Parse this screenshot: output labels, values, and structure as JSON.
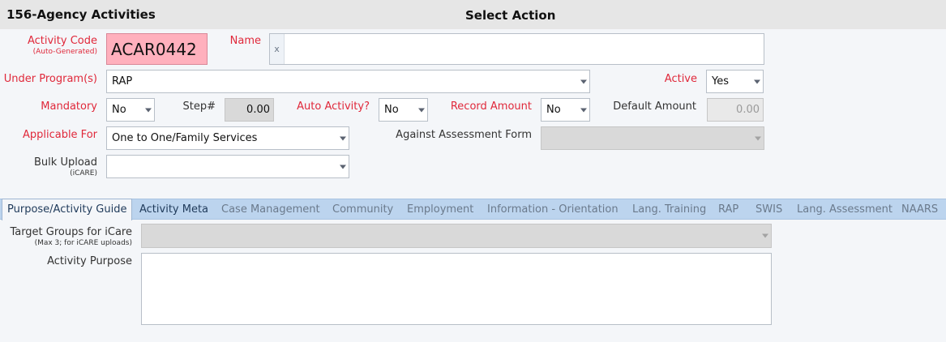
{
  "header": {
    "module_title": "156-Agency Activities",
    "action_title": "Select Action"
  },
  "form": {
    "activity_code": {
      "label": "Activity Code",
      "sub_label": "(Auto-Generated)",
      "value": "ACAR0442"
    },
    "name": {
      "label": "Name",
      "prefix": "x",
      "value": ""
    },
    "under_program": {
      "label": "Under Program(s)",
      "value": "RAP"
    },
    "active": {
      "label": "Active",
      "value": "Yes"
    },
    "mandatory": {
      "label": "Mandatory",
      "value": "No"
    },
    "step": {
      "label": "Step#",
      "value": "0.00"
    },
    "auto_activity": {
      "label": "Auto Activity?",
      "value": "No"
    },
    "record_amount": {
      "label": "Record Amount",
      "value": "No"
    },
    "default_amount": {
      "label": "Default Amount",
      "value": "0.00"
    },
    "applicable_for": {
      "label": "Applicable For",
      "value": "One to One/Family Services"
    },
    "against_assessment_form": {
      "label": "Against Assessment Form",
      "value": ""
    },
    "bulk_upload": {
      "label": "Bulk Upload",
      "sub_label": "(iCARE)",
      "value": ""
    }
  },
  "tabs": [
    {
      "label": "Purpose/Activity Guide"
    },
    {
      "label": "Activity Meta"
    },
    {
      "label": "Case Management"
    },
    {
      "label": "Community"
    },
    {
      "label": "Employment"
    },
    {
      "label": "Information - Orientation"
    },
    {
      "label": "Lang. Training"
    },
    {
      "label": "RAP"
    },
    {
      "label": "SWIS"
    },
    {
      "label": "Lang. Assessment"
    },
    {
      "label": "NAARS"
    }
  ],
  "tab_content": {
    "target_groups": {
      "label": "Target Groups for iCare",
      "sub_label": "(Max 3; for iCARE uploads)",
      "value": ""
    },
    "activity_purpose": {
      "label": "Activity Purpose",
      "value": ""
    }
  },
  "colors": {
    "required_label": "#e0283a",
    "tab_bar": "#bcd4ee",
    "code_bg": "#ffb0bd"
  }
}
